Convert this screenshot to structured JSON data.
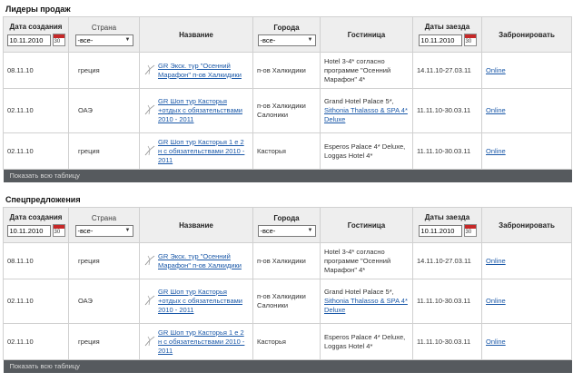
{
  "sections": [
    {
      "title": "Лидеры продаж",
      "header": {
        "created_label": "Дата создания",
        "created_value": "10.11.2010",
        "calendar_num": "30",
        "country_label": "Страна",
        "country_value": "-все-",
        "name_label": "Название",
        "city_label": "Города",
        "city_value": "-все-",
        "hotel_label": "Гостиница",
        "dates_label": "Даты заезда",
        "dates_value": "10.11.2010",
        "book_label": "Забронировать"
      },
      "rows": [
        {
          "date": "08.11.10",
          "country": "греция",
          "name": "GR Экск. тур \"Осенний Марафон\" п-ов Халкидики",
          "city": "п-ов Халкидики",
          "hotel_plain": "Hotel 3-4* согласно программе \"Осенний Марафон\" 4*",
          "hotel_link": "",
          "hotel_tail": "",
          "dates": "14.11.10-27.03.11",
          "book": "Online"
        },
        {
          "date": "02.11.10",
          "country": "ОАЭ",
          "name": "GR Шоп тур Касторья +отдых с обязательствами 2010 - 2011",
          "city": "п-ов Халкидики Салоники",
          "hotel_plain": "Grand Hotel Palace 5*,",
          "hotel_link": "Sithonia Thalasso & SPA 4* Deluxe",
          "hotel_tail": "",
          "dates": "11.11.10-30.03.11",
          "book": "Online"
        },
        {
          "date": "02.11.10",
          "country": "греция",
          "name": "GR Шоп тур Касторья 1 е 2 н с обязательствами 2010 - 2011",
          "city": "Касторья",
          "hotel_plain": "Esperos Palace 4* Deluxe, Loggas Hotel 4*",
          "hotel_link": "",
          "hotel_tail": "",
          "dates": "11.11.10-30.03.11",
          "book": "Online"
        }
      ],
      "footer": "Показать всю таблицу"
    },
    {
      "title": "Спецпредложения",
      "header": {
        "created_label": "Дата создания",
        "created_value": "10.11.2010",
        "calendar_num": "30",
        "country_label": "Страна",
        "country_value": "-все-",
        "name_label": "Название",
        "city_label": "Города",
        "city_value": "-все-",
        "hotel_label": "Гостиница",
        "dates_label": "Даты заезда",
        "dates_value": "10.11.2010",
        "book_label": "Забронировать"
      },
      "rows": [
        {
          "date": "08.11.10",
          "country": "греция",
          "name": "GR Экск. тур \"Осенний Марафон\" п-ов Халкидики",
          "city": "п-ов Халкидики",
          "hotel_plain": "Hotel 3-4* согласно программе \"Осенний Марафон\" 4*",
          "hotel_link": "",
          "hotel_tail": "",
          "dates": "14.11.10-27.03.11",
          "book": "Online"
        },
        {
          "date": "02.11.10",
          "country": "ОАЭ",
          "name": "GR Шоп тур Касторья +отдых с обязательствами 2010 - 2011",
          "city": "п-ов Халкидики Салоники",
          "hotel_plain": "Grand Hotel Palace 5*,",
          "hotel_link": "Sithonia Thalasso & SPA 4* Deluxe",
          "hotel_tail": "",
          "dates": "11.11.10-30.03.11",
          "book": "Online"
        },
        {
          "date": "02.11.10",
          "country": "греция",
          "name": "GR Шоп тур Касторья 1 е 2 н с обязательствами 2010 - 2011",
          "city": "Касторья",
          "hotel_plain": "Esperos Palace 4* Deluxe, Loggas Hotel 4*",
          "hotel_link": "",
          "hotel_tail": "",
          "dates": "11.11.10-30.03.11",
          "book": "Online"
        }
      ],
      "footer": "Показать всю таблицу"
    }
  ]
}
